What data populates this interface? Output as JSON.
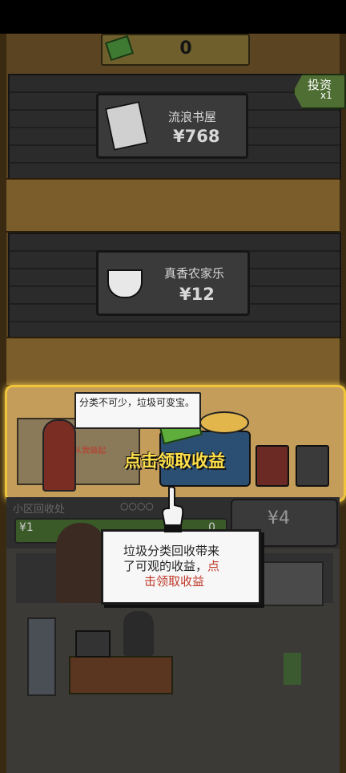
{
  "top_counter": {
    "value": "0"
  },
  "invest_button": {
    "label": "投资",
    "multiplier": "x1"
  },
  "stores": [
    {
      "name": "流浪书屋",
      "price": "¥768",
      "icon": "book-icon"
    },
    {
      "name": "真香农家乐",
      "price": "¥12",
      "icon": "rice-bowl-icon"
    }
  ],
  "recycle_station": {
    "speech": "分类不可少，垃圾可变宝。",
    "board_text": "分 从我做起",
    "collect_text": "点击领取收益",
    "name": "小区回收处",
    "earning": "¥1",
    "earning_tail": "0",
    "price": "¥4"
  },
  "tutorial": {
    "line1": "垃圾分类回收带来",
    "line2_prefix": "了可观的收益，",
    "line2_red": "点",
    "line3_red": "击领取收益"
  },
  "colors": {
    "highlight": "#f0c53b",
    "red_text": "#c0392b",
    "green": "#4f6e33"
  }
}
